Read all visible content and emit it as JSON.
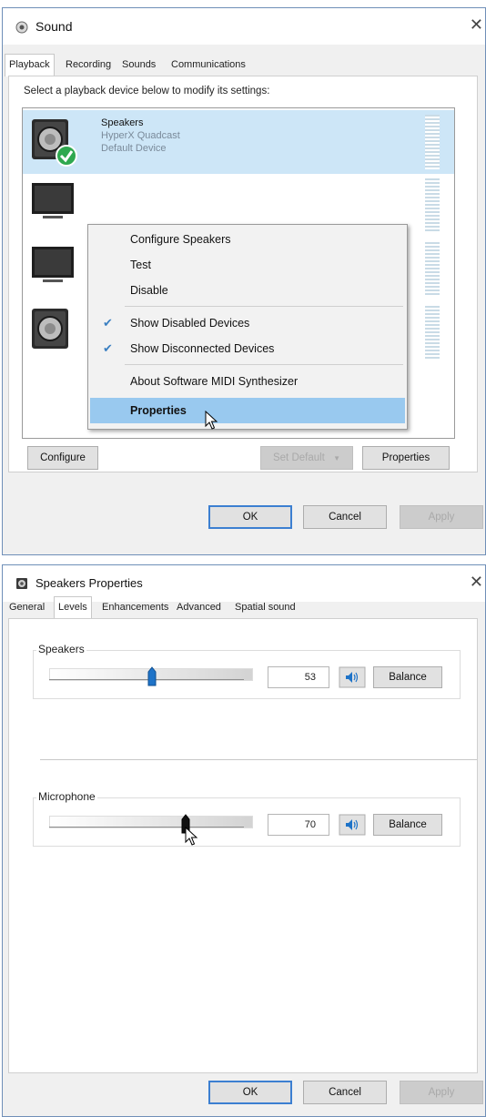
{
  "sound_dialog": {
    "title": "Sound",
    "close": "✕",
    "tabs": [
      "Playback",
      "Recording",
      "Sounds",
      "Communications"
    ],
    "instruction": "Select a playback device below to modify its settings:",
    "devices": [
      {
        "name": "Speakers",
        "line1": "HyperX Quadcast",
        "line2": "Default Device",
        "icon": "speaker-default-icon"
      },
      {
        "icon": "monitor-icon"
      },
      {
        "icon": "monitor-icon"
      },
      {
        "icon": "speaker-icon"
      }
    ],
    "context_menu": {
      "items": [
        {
          "label": "Configure Speakers",
          "checked": false
        },
        {
          "label": "Test",
          "checked": false
        },
        {
          "label": "Disable",
          "checked": false
        },
        {
          "label": "Show Disabled Devices",
          "checked": true
        },
        {
          "label": "Show Disconnected Devices",
          "checked": true
        },
        {
          "label": "About Software MIDI Synthesizer",
          "checked": false
        },
        {
          "label": "Properties",
          "checked": false,
          "highlighted": true
        }
      ],
      "check_glyph": "✔"
    },
    "buttons": {
      "configure": "Configure",
      "set_default": "Set Default",
      "set_default_arrow": "▼",
      "properties": "Properties",
      "ok": "OK",
      "cancel": "Cancel",
      "apply": "Apply"
    }
  },
  "properties_dialog": {
    "title": "Speakers Properties",
    "close": "✕",
    "tabs": [
      "General",
      "Levels",
      "Enhancements",
      "Advanced",
      "Spatial sound"
    ],
    "active_tab": "Levels",
    "levels": [
      {
        "label": "Speakers",
        "value": "53",
        "level": 0.53,
        "balance": "Balance"
      },
      {
        "label": "Microphone",
        "value": "70",
        "level": 0.7,
        "balance": "Balance"
      }
    ],
    "buttons": {
      "ok": "OK",
      "cancel": "Cancel",
      "apply": "Apply"
    }
  },
  "colors": {
    "selection": "#cde6f7",
    "menu_highlight": "#99c9ef",
    "accent": "#1e73c8",
    "default_badge": "#2fa84f"
  }
}
